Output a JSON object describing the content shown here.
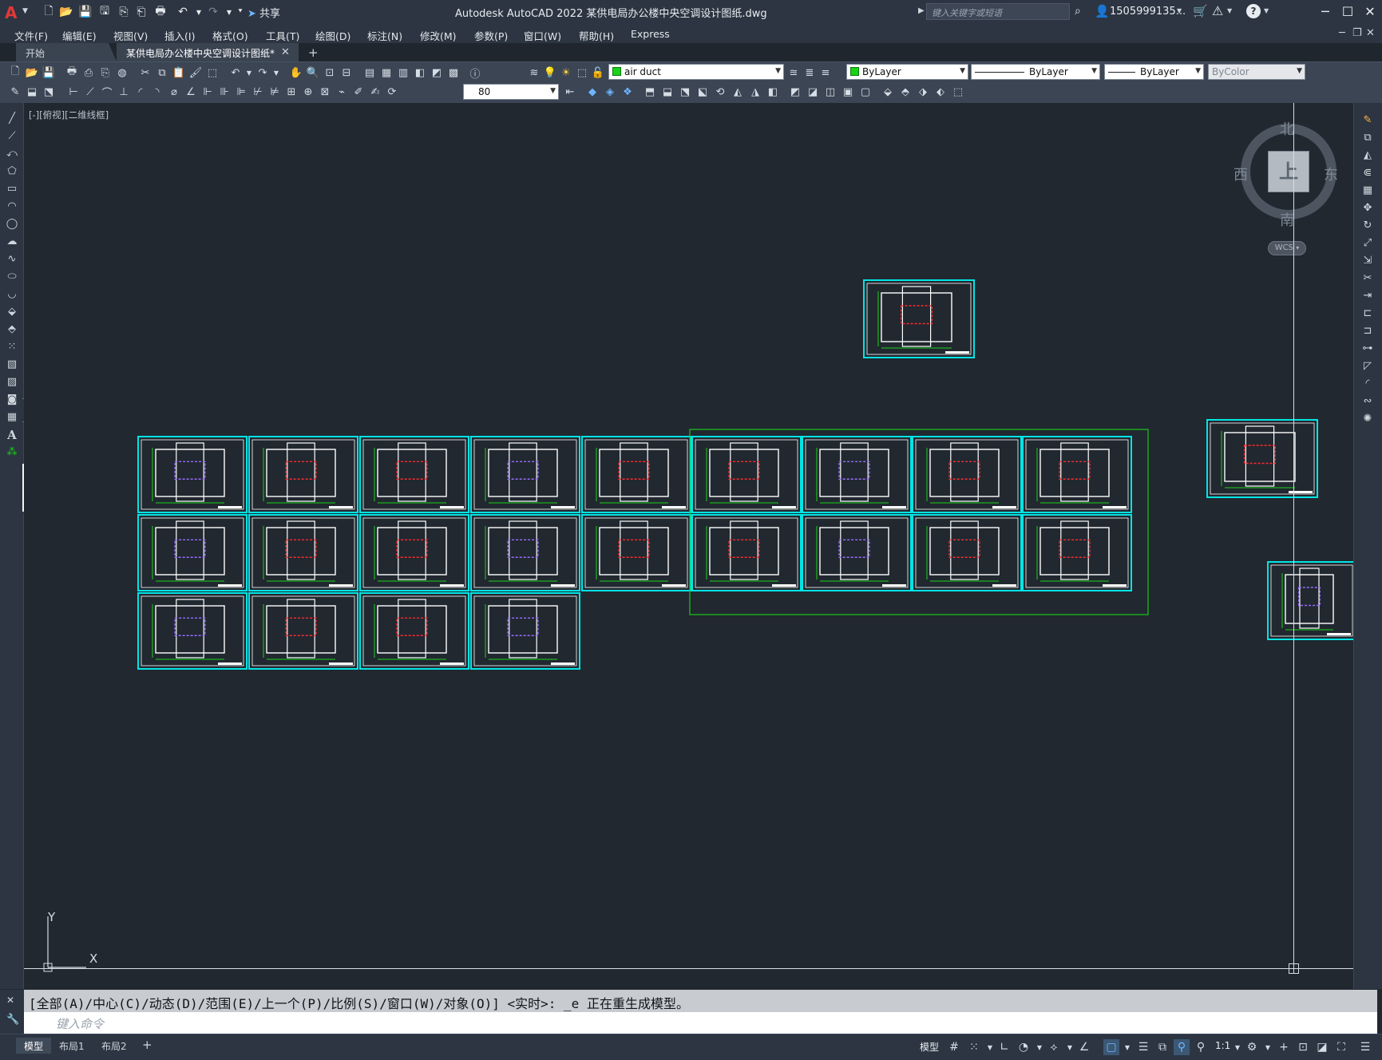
{
  "titlebar": {
    "app_title": "Autodesk AutoCAD 2022    某供电局办公楼中央空调设计图纸.dwg",
    "share_label": "共享",
    "search_placeholder": "键入关键字或短语",
    "user_name": "1505999135...",
    "icons": [
      "autocad-logo",
      "new-icon",
      "open-icon",
      "save-icon",
      "save-as-icon",
      "open-from-web-icon",
      "save-to-web-icon",
      "plot-icon",
      "undo-icon",
      "redo-icon",
      "share-icon",
      "search-icon",
      "user-icon",
      "cart-icon",
      "autodesk-a360-icon",
      "help-icon"
    ]
  },
  "menubar": {
    "items": [
      "文件(F)",
      "编辑(E)",
      "视图(V)",
      "插入(I)",
      "格式(O)",
      "工具(T)",
      "绘图(D)",
      "标注(N)",
      "修改(M)",
      "参数(P)",
      "窗口(W)",
      "帮助(H)",
      "Express"
    ]
  },
  "tabs": {
    "start": "开始",
    "document": "某供电局办公楼中央空调设计图纸*"
  },
  "toolbar": {
    "layer_name": "air duct",
    "color": "ByLayer",
    "linetype": "ByLayer",
    "lineweight": "ByLayer",
    "plotstyle": "ByColor",
    "dim_value": "80"
  },
  "viewport": {
    "label": "[-][俯视][二维线框]"
  },
  "viewcube": {
    "north": "北",
    "south": "南",
    "east": "东",
    "west": "西",
    "face": "上",
    "wcs": "WCS"
  },
  "ucs": {
    "x": "X",
    "y": "Y"
  },
  "command": {
    "history": "[全部(A)/中心(C)/动态(D)/范围(E)/上一个(P)/比例(S)/窗口(W)/对象(O)] <实时>: _e 正在重生成模型。",
    "placeholder": "键入命令"
  },
  "statusbar": {
    "layouts": [
      "模型",
      "布局1",
      "布局2"
    ],
    "model_label": "模型",
    "scale_label": "1:1"
  },
  "colors": {
    "canvas": "#212830",
    "sheet_frame": "#00e5e5",
    "selection_frame": "#19c819",
    "accent": "#6fb6ff"
  }
}
